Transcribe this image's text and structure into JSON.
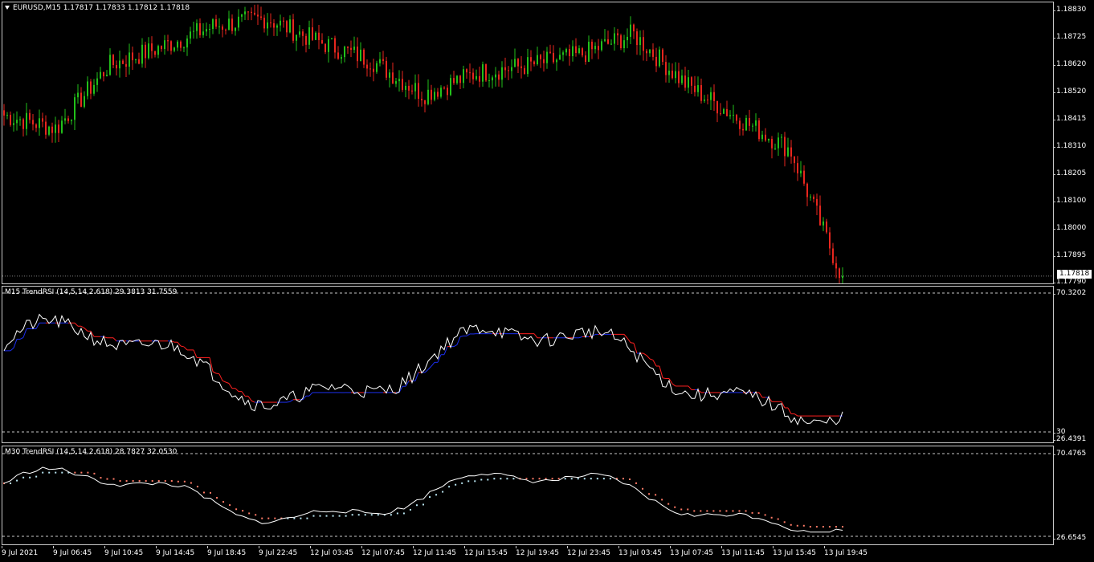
{
  "main": {
    "title": "EURUSD,M15  1.17817 1.17833 1.17812 1.17818",
    "price_ticks": [
      "1.18830",
      "1.18725",
      "1.18620",
      "1.18520",
      "1.18415",
      "1.18310",
      "1.18205",
      "1.18100",
      "1.18000",
      "1.17895",
      "1.17790"
    ],
    "current_price": "1.17818",
    "ylim": [
      1.1779,
      1.1886
    ]
  },
  "ind1": {
    "title": "M15 TrendRSI (14,5,14,2.618) 29.3813 31.7559",
    "levels": [
      "70.3202",
      "70",
      "30",
      "26.4391"
    ]
  },
  "ind2": {
    "title": "M30 TrendRSI (14,5,14,2.618) 28.7827 32.0530",
    "levels": [
      "70.4765",
      "70",
      "30",
      "26.6545"
    ]
  },
  "xaxis": {
    "labels": [
      "9 Jul 2021",
      "9 Jul 06:45",
      "9 Jul 10:45",
      "9 Jul 14:45",
      "9 Jul 18:45",
      "9 Jul 22:45",
      "12 Jul 03:45",
      "12 Jul 07:45",
      "12 Jul 11:45",
      "12 Jul 15:45",
      "12 Jul 19:45",
      "12 Jul 23:45",
      "13 Jul 03:45",
      "13 Jul 07:45",
      "13 Jul 11:45",
      "13 Jul 15:45",
      "13 Jul 19:45"
    ]
  },
  "colors": {
    "bull": "#22c11a",
    "bear": "#e8261e",
    "rsi": "#ffffff",
    "trend_red": "#ff2020",
    "trend_blue": "#1c2ff0",
    "dot_salmon": "#ff7a66",
    "dot_lightblue": "#b8e4f0"
  },
  "chart_data": {
    "type": "line",
    "title": "EURUSD,M15",
    "x": [
      "9 Jul 2021",
      "9 Jul 06:45",
      "9 Jul 10:45",
      "9 Jul 14:45",
      "9 Jul 18:45",
      "9 Jul 22:45",
      "12 Jul 03:45",
      "12 Jul 07:45",
      "12 Jul 11:45",
      "12 Jul 15:45",
      "12 Jul 19:45",
      "12 Jul 23:45",
      "13 Jul 03:45",
      "13 Jul 07:45",
      "13 Jul 11:45",
      "13 Jul 15:45",
      "13 Jul 19:45"
    ],
    "series": [
      {
        "name": "EURUSD,M15",
        "values": [
          1.1843,
          1.1838,
          1.1862,
          1.1869,
          1.1877,
          1.188,
          1.1871,
          1.1864,
          1.1851,
          1.1859,
          1.1862,
          1.1866,
          1.1874,
          1.1855,
          1.1842,
          1.183,
          1.1781
        ]
      }
    ],
    "ylim": [
      1.1779,
      1.1886
    ]
  }
}
